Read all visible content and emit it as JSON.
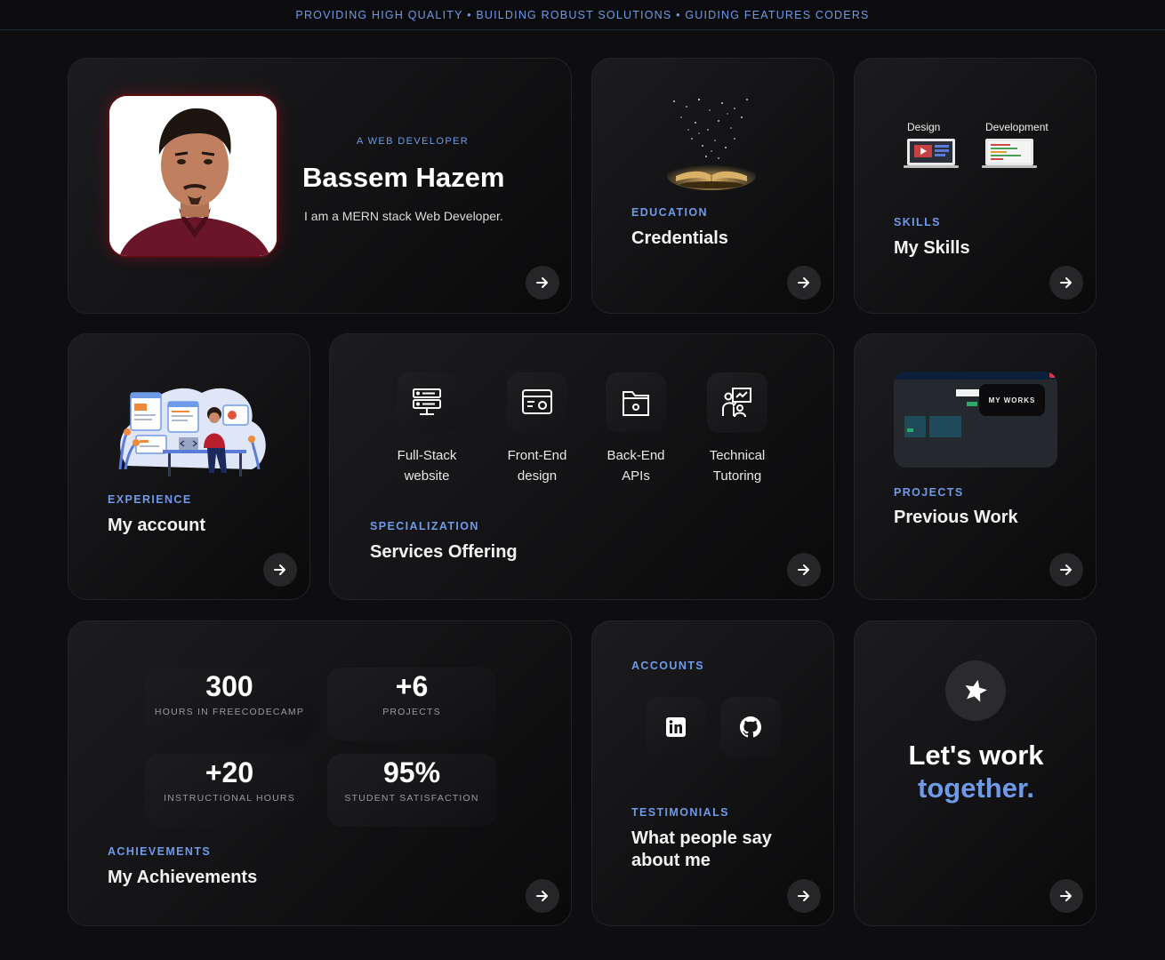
{
  "ticker": "PROVIDING HIGH QUALITY • BUILDING ROBUST SOLUTIONS • GUIDING FEATURES CODERS",
  "profile": {
    "kicker": "A WEB DEVELOPER",
    "name": "Bassem Hazem",
    "bio": "I am a MERN stack Web Developer."
  },
  "credentials": {
    "kicker": "EDUCATION",
    "title": "Credentials"
  },
  "skills": {
    "kicker": "SKILLS",
    "title": "My Skills",
    "label_design": "Design",
    "label_dev": "Development"
  },
  "experience": {
    "kicker": "EXPERIENCE",
    "title": "My account"
  },
  "services": {
    "kicker": "SPECIALIZATION",
    "title": "Services Offering",
    "items": [
      {
        "line1": "Full-Stack",
        "line2": "website",
        "icon": "server-icon"
      },
      {
        "line1": "Front-End",
        "line2": "design",
        "icon": "browser-window-icon"
      },
      {
        "line1": "Back-End",
        "line2": "APIs",
        "icon": "folder-api-icon"
      },
      {
        "line1": "Technical",
        "line2": "Tutoring",
        "icon": "teacher-board-icon"
      }
    ]
  },
  "projects": {
    "kicker": "PROJECTS",
    "title": "Previous Work",
    "preview_label": "MY WORKS"
  },
  "achievements": {
    "kicker": "ACHIEVEMENTS",
    "title": "My Achievements",
    "stats": [
      {
        "value": "300",
        "caption": "HOURS IN FREECODECAMP"
      },
      {
        "value": "+6",
        "caption": "PROJECTS"
      },
      {
        "value": "+20",
        "caption": "INSTRUCTIONAL HOURS"
      },
      {
        "value": "95%",
        "caption": "STUDENT SATISFACTION"
      }
    ]
  },
  "accounts": {
    "kicker": "ACCOUNTS",
    "icons": [
      "linkedin-icon",
      "github-icon"
    ]
  },
  "testimonials": {
    "kicker": "TESTIMONIALS",
    "title_line1": "What people say",
    "title_line2": "about me"
  },
  "cta": {
    "line1": "Let's work",
    "line2": "together.",
    "accent": "#6f9ae8"
  },
  "colors": {
    "accent": "#6f9ae8",
    "background": "#0e0e10",
    "card": "#161618"
  }
}
